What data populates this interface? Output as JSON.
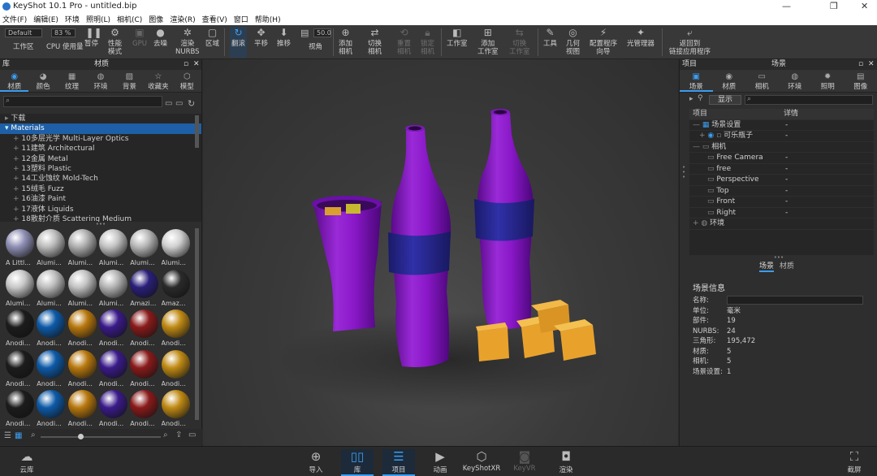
{
  "title": "KeyShot 10.1 Pro - untitled.bip",
  "menu": [
    "文件(F)",
    "编辑(E)",
    "环境",
    "照明(L)",
    "相机(C)",
    "图像",
    "渲染(R)",
    "查看(V)",
    "窗口",
    "帮助(H)"
  ],
  "toolbar": {
    "workspace_value": "Default",
    "workspace_label": "工作区",
    "cpu_value": "83 %",
    "cpu_label": "CPU 使用量",
    "pause": "暂停",
    "perf": "性能\n模式",
    "gpu": "GPU",
    "denoise": "去噪",
    "render_nurbs": "渲染\nNURBS",
    "region": "区域",
    "tumble": "翻滚",
    "pan": "平移",
    "dolly": "推移",
    "fov_value": "50.0",
    "fov": "视角",
    "add_camera": "添加\n相机",
    "switch_camera": "切换\n相机",
    "reset_camera": "重置\n相机",
    "lock_camera": "锁定\n相机",
    "studio": "工作室",
    "add_studio": "添加\n工作室",
    "switch_studio": "切换\n工作室",
    "tools": "工具",
    "geometry_view": "几何\n视图",
    "config_wizard": "配置程序\n向导",
    "light_manager": "光管理器",
    "return_app": "返回到\n链接应用程序"
  },
  "left_panel": {
    "header_left": "库",
    "header_title": "材质",
    "tabs": [
      "材质",
      "颜色",
      "纹理",
      "环境",
      "背景",
      "收藏夹",
      "模型"
    ],
    "tree": [
      "下载",
      "Materials",
      "10多层光学 Multi-Layer Optics",
      "11建筑 Architectural",
      "12金属 Metal",
      "13塑料 Plastic",
      "14工业蚀纹 Mold-Tech",
      "15绒毛 Fuzz",
      "16油漆 Paint",
      "17液体 Liquids",
      "18散射介质 Scattering Medium"
    ],
    "materials": [
      {
        "label": "A Littl...",
        "color": "#8f8fb5"
      },
      {
        "label": "Alumi...",
        "color": "#bcbcbc"
      },
      {
        "label": "Alumi...",
        "color": "#b0b0b0"
      },
      {
        "label": "Alumi...",
        "color": "#c4c4c4"
      },
      {
        "label": "Alumi...",
        "color": "#b8b8b8"
      },
      {
        "label": "Alumi...",
        "color": "#d0d0d0"
      },
      {
        "label": "Alumi...",
        "color": "#c8c8c8"
      },
      {
        "label": "Alumi...",
        "color": "#bdbdbd"
      },
      {
        "label": "Alumi...",
        "color": "#c2c2c2"
      },
      {
        "label": "Alumi...",
        "color": "#b4b4b4"
      },
      {
        "label": "Amazi...",
        "color": "#2a1f7a"
      },
      {
        "label": "Amaz...",
        "color": "#2a2a2a"
      },
      {
        "label": "Anodi...",
        "color": "#1c1c1c"
      },
      {
        "label": "Anodi...",
        "color": "#0d5aa8"
      },
      {
        "label": "Anodi...",
        "color": "#b8780e"
      },
      {
        "label": "Anodi...",
        "color": "#3a1a8a"
      },
      {
        "label": "Anodi...",
        "color": "#8a1a1a"
      },
      {
        "label": "Anodi...",
        "color": "#c08a14"
      },
      {
        "label": "Anodi...",
        "color": "#1c1c1c"
      },
      {
        "label": "Anodi...",
        "color": "#0d5aa8"
      },
      {
        "label": "Anodi...",
        "color": "#b8780e"
      },
      {
        "label": "Anodi...",
        "color": "#3a1a8a"
      },
      {
        "label": "Anodi...",
        "color": "#8a1a1a"
      },
      {
        "label": "Anodi...",
        "color": "#c08a14"
      },
      {
        "label": "Anodi...",
        "color": "#1c1c1c"
      },
      {
        "label": "Anodi...",
        "color": "#0d5aa8"
      },
      {
        "label": "Anodi...",
        "color": "#b8780e"
      },
      {
        "label": "Anodi...",
        "color": "#3a1a8a"
      },
      {
        "label": "Anodi...",
        "color": "#8a1a1a"
      },
      {
        "label": "Anodi...",
        "color": "#c08a14"
      }
    ]
  },
  "right_panel": {
    "header_left": "项目",
    "header_title": "场景",
    "tabs": [
      "场景",
      "材质",
      "相机",
      "环境",
      "照明",
      "图像"
    ],
    "show_label": "显示",
    "col_item": "项目",
    "col_detail": "详情",
    "rows": [
      {
        "name": "场景设置",
        "val": "-"
      },
      {
        "name": "可乐瓶子",
        "val": "-"
      },
      {
        "name": "相机",
        "val": ""
      },
      {
        "name": "Free Camera",
        "val": "-"
      },
      {
        "name": "free",
        "val": "-"
      },
      {
        "name": "Perspective",
        "val": "-"
      },
      {
        "name": "Top",
        "val": "-"
      },
      {
        "name": "Front",
        "val": "-"
      },
      {
        "name": "Right",
        "val": "-"
      },
      {
        "name": "环境",
        "val": ""
      }
    ],
    "subtabs": [
      "场景",
      "材质"
    ],
    "info_title": "场景信息",
    "info": [
      {
        "k": "名称:",
        "v": ""
      },
      {
        "k": "单位:",
        "v": "毫米"
      },
      {
        "k": "部件:",
        "v": "19"
      },
      {
        "k": "NURBS:",
        "v": "24"
      },
      {
        "k": "三角形:",
        "v": "195,472"
      },
      {
        "k": "材质:",
        "v": "5"
      },
      {
        "k": "相机:",
        "v": "5"
      },
      {
        "k": "场景设置:",
        "v": "1"
      }
    ]
  },
  "bottom": {
    "cloud": "云库",
    "import": "导入",
    "library": "库",
    "project": "项目",
    "animation": "动画",
    "keyshotxr": "KeyShotXR",
    "render_dim": "KeyVR",
    "render": "渲染",
    "screenshot": "截屏"
  },
  "colors": {
    "accent": "#3b9ef0",
    "bottle": "#8a18c8",
    "label": "#2a2a9a",
    "cube": "#e8a22c"
  }
}
